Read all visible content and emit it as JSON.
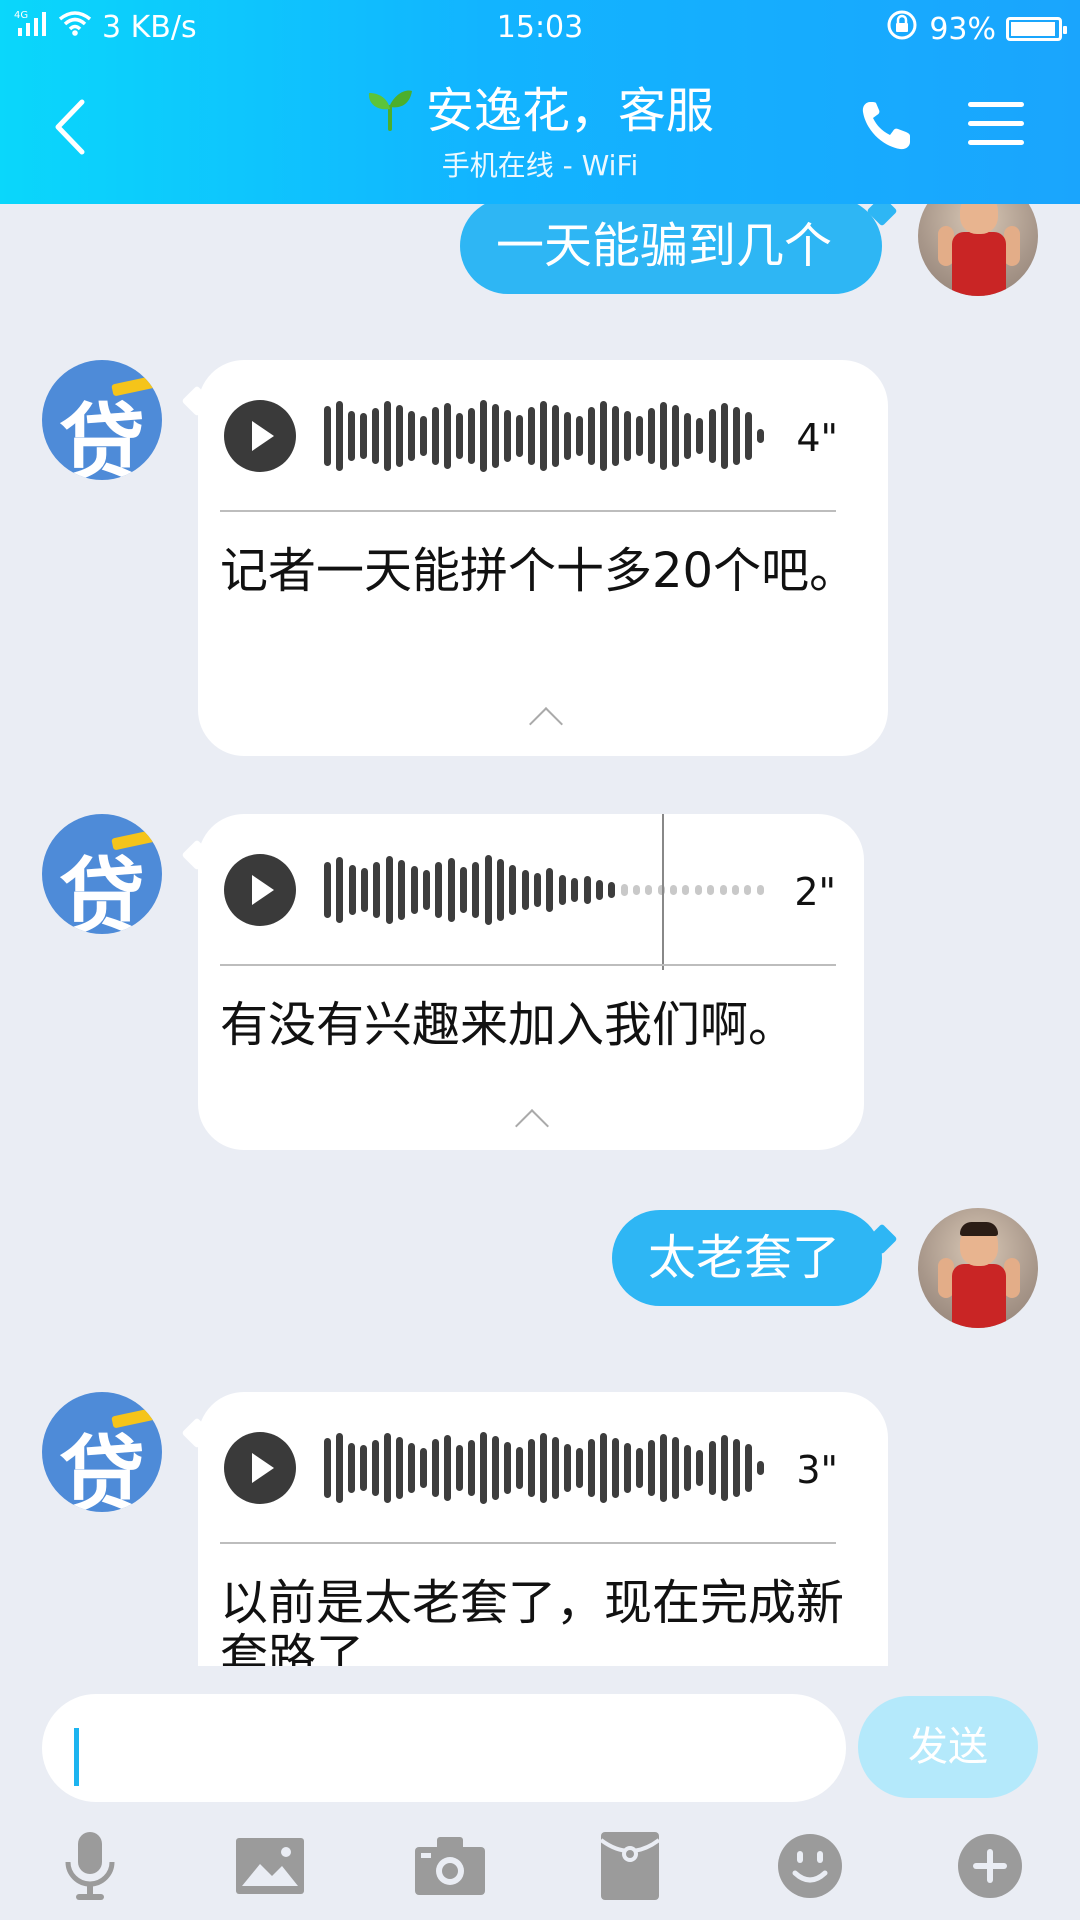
{
  "status_bar": {
    "network": "4G",
    "speed": "3 KB/s",
    "time": "15:03",
    "battery": "93%"
  },
  "header": {
    "title": "安逸花，客服",
    "subtitle": "手机在线 - WiFi"
  },
  "messages": [
    {
      "side": "out",
      "text": "一天能骗到几个"
    },
    {
      "side": "in",
      "duration": "4\"",
      "transcript": "记者一天能拼个十多20个吧。"
    },
    {
      "side": "in",
      "duration": "2\"",
      "transcript": "有没有兴趣来加入我们啊。"
    },
    {
      "side": "out",
      "text": "太老套了"
    },
    {
      "side": "in",
      "duration": "3\"",
      "transcript": "以前是太老套了，现在完成新套路了"
    }
  ],
  "bot_avatar_glyph": "贷",
  "composer": {
    "send_label": "发送",
    "tools": [
      "microphone-icon",
      "image-icon",
      "camera-icon",
      "red-packet-icon",
      "emoji-icon",
      "plus-icon"
    ]
  },
  "colors": {
    "header_start": "#0ad7fb",
    "header_end": "#1aa5fd",
    "outgoing_bubble": "#2eb6f4",
    "send_button": "#b4e9fb",
    "background": "#eaedf4"
  }
}
